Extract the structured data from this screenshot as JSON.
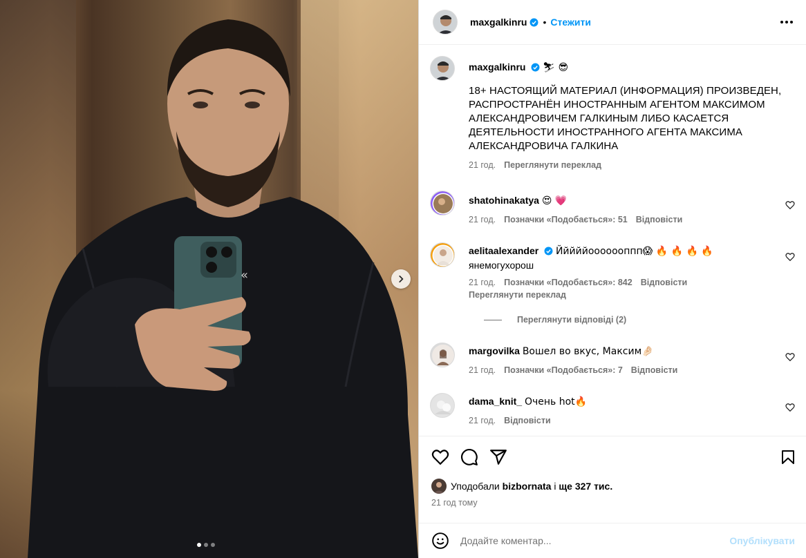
{
  "post": {
    "author": "maxgalkinru",
    "follow_label": "Стежити",
    "caption_emoji": "⛷ 😎",
    "caption": "18+ НАСТОЯЩИЙ МАТЕРИАЛ (ИНФОРМАЦИЯ) ПРОИЗВЕДЕН, РАСПРОСТРАНЁН ИНОСТРАННЫМ АГЕНТОМ МАКСИМОМ АЛЕКСАНДРОВИЧЕМ ГАЛКИНЫМ ЛИБО КАСАЕТСЯ ДЕЯТЕЛЬНОСТИ ИНОСТРАННОГО АГЕНТА МАКСИМА АЛЕКСАНДРОВИЧА ГАЛКИНА",
    "caption_time": "21 год.",
    "caption_translate": "Переглянути переклад",
    "carousel_dots": 3
  },
  "comments": [
    {
      "user": "shatohinakatya",
      "text": "😍 💗",
      "time": "21 год.",
      "likes": "Позначки «Подобається»: 51",
      "reply": "Відповісти"
    },
    {
      "user": "aelitaalexander",
      "verified": true,
      "text": "Йййййооооооппп😱 🔥 🔥 🔥 🔥",
      "text2": "янемогухорош",
      "time": "21 год.",
      "likes": "Позначки «Подобається»: 842",
      "reply": "Відповісти",
      "translate": "Переглянути переклад",
      "view_replies": "Переглянути відповіді (2)"
    },
    {
      "user": "margovilka",
      "text": "Вошел во вкус, Максим🤌🏻",
      "time": "21 год.",
      "likes": "Позначки «Подобається»: 7",
      "reply": "Відповісти"
    },
    {
      "user": "dama_knit_",
      "text": "Очень hot🔥",
      "time": "21 год.",
      "reply": "Відповісти"
    }
  ],
  "likes_summary": {
    "prefix": "Уподобали",
    "user": "bizbornata",
    "middle": "і",
    "count": "ще 327 тис."
  },
  "time_ago": "21 год тому",
  "comment_box": {
    "placeholder": "Додайте коментар...",
    "post_label": "Опублікувати"
  },
  "colors": {
    "accent": "#0095f6",
    "post_disabled": "#b2dffc",
    "muted": "#737373",
    "verified": "#0095f6"
  },
  "icons": [
    "chevron-right-icon",
    "more-icon",
    "verified-icon",
    "heart-icon",
    "comment-icon",
    "share-icon",
    "bookmark-icon",
    "emoji-icon"
  ]
}
